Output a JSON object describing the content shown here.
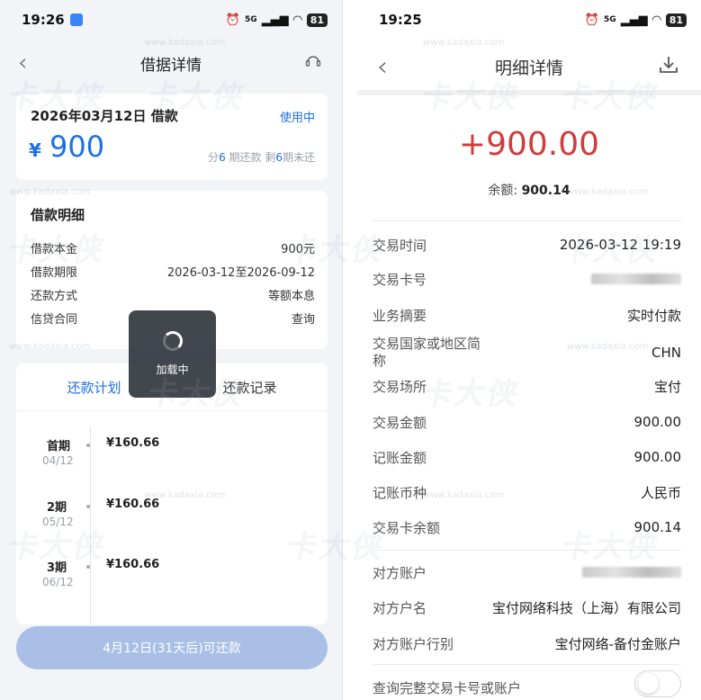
{
  "left": {
    "status": {
      "time": "19:26",
      "signal": "5G",
      "battery": "81"
    },
    "nav": {
      "title": "借据详情"
    },
    "loan": {
      "date_title": "2026年03月12日 借款",
      "status": "使用中",
      "currency": "¥",
      "amount": "900",
      "installments_prefix": "分",
      "installments_total": "6",
      "installments_mid": " 期还款 剩",
      "installments_left": "6",
      "installments_suffix": "期未还"
    },
    "detail": {
      "heading": "借款明细",
      "rows": [
        {
          "label": "借款本金",
          "value": "900元"
        },
        {
          "label": "借款期限",
          "value": "2026-03-12至2026-09-12"
        },
        {
          "label": "还款方式",
          "value": "等额本息"
        },
        {
          "label": "信贷合同",
          "value": "查询"
        }
      ]
    },
    "loading_text": "加载中",
    "tabs": [
      {
        "label": "还款计划"
      },
      {
        "label": "还款记录"
      }
    ],
    "plan": [
      {
        "period": "首期",
        "date": "04/12",
        "amount": "¥160.66"
      },
      {
        "period": "2期",
        "date": "05/12",
        "amount": "¥160.66"
      },
      {
        "period": "3期",
        "date": "06/12",
        "amount": "¥160.66"
      }
    ],
    "bottom_button": "4月12日(31天后)可还款"
  },
  "right": {
    "status": {
      "time": "19:25",
      "signal": "5G",
      "battery": "81"
    },
    "nav": {
      "title": "明细详情"
    },
    "amount": "+900.00",
    "balance_label": "余额: ",
    "balance_value": "900.14",
    "rows": [
      {
        "label": "交易时间",
        "value": "2026-03-12 19:19"
      },
      {
        "label": "交易卡号",
        "value": ""
      },
      {
        "label": "业务摘要",
        "value": "实时付款"
      },
      {
        "label": "交易国家或地区简称",
        "value": "CHN"
      },
      {
        "label": "交易场所",
        "value": "宝付"
      },
      {
        "label": "交易金额",
        "value": "900.00"
      },
      {
        "label": "记账金额",
        "value": "900.00"
      },
      {
        "label": "记账币种",
        "value": "人民币"
      },
      {
        "label": "交易卡余额",
        "value": "900.14"
      },
      {
        "label": "对方账户",
        "value": ""
      },
      {
        "label": "对方户名",
        "value": "宝付网络科技（上海）有限公司"
      },
      {
        "label": "对方账户行别",
        "value": "宝付网络-备付金账户"
      },
      {
        "label": "查询完整交易卡号或账户",
        "value": ""
      }
    ],
    "colors": {
      "amount": "#d23c3c"
    }
  },
  "watermark": {
    "text": "卡大侠",
    "url": "www.kadaxia.com"
  }
}
